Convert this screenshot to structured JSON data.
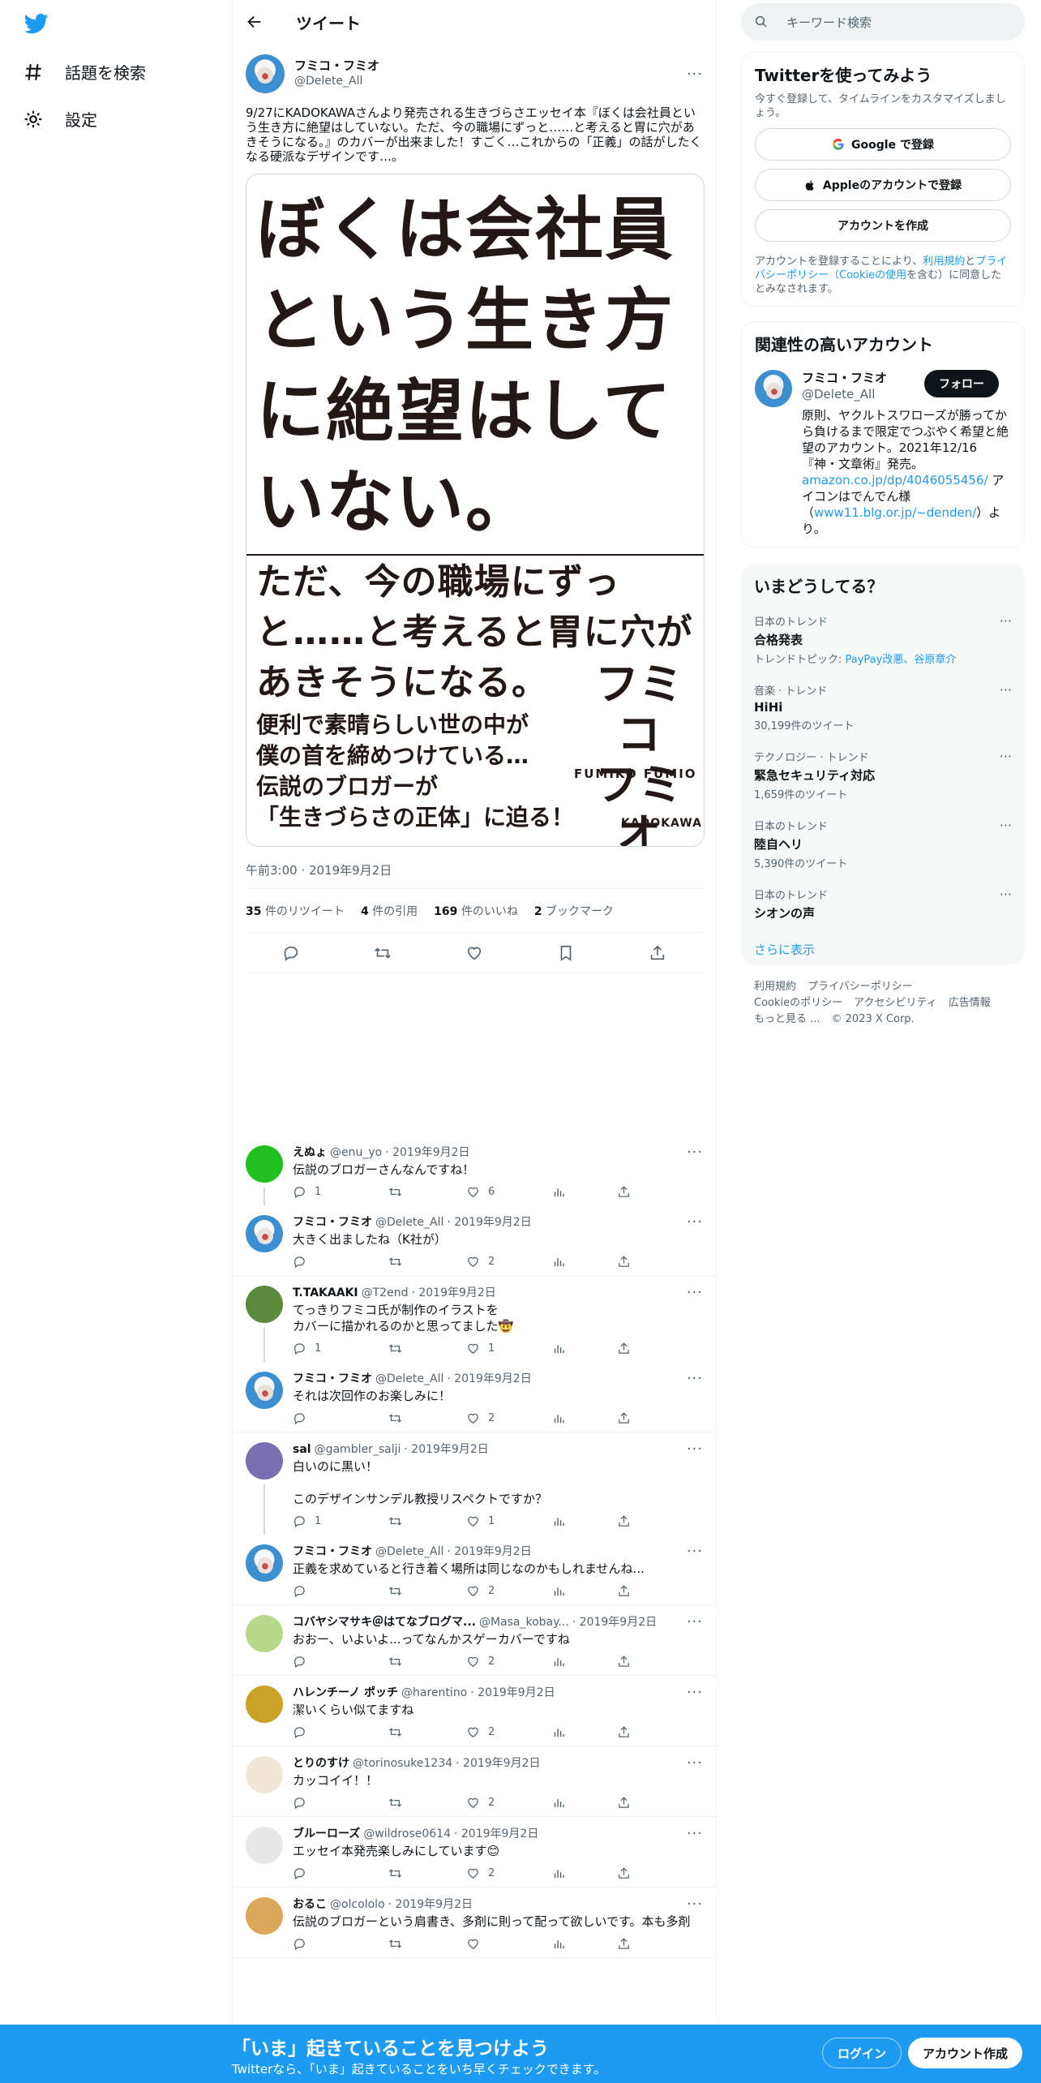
{
  "nav": {
    "explore_label": "話題を検索",
    "settings_label": "設定"
  },
  "header": {
    "title": "ツイート"
  },
  "tweet": {
    "name": "フミコ・フミオ",
    "handle": "@Delete_All",
    "text": "9/27にKADOKAWAさんより発売される生きづらさエッセイ本『ぼくは会社員という生き方に絶望はしていない。ただ、今の職場にずっと……と考えると胃に穴があきそうになる。』のカバーが出来ました！すごく…これからの「正義」の話がしたくなる硬派なデザインです…。",
    "time": "午前3:00 · 2019年9月2日",
    "cover": {
      "title": "ぼくは会社員という生き方に絶望はしていない。",
      "subtitle": "ただ、今の職場にずっと……と考えると胃に穴があきそうになる。",
      "tagline": "便利で素晴らしい世の中が\n僕の首を締めつけている…\n伝説のブロガーが\n「生きづらさの正体」に迫る！",
      "author": "フミコ\nフミオ",
      "author_en": "FUMIKO FUMIO",
      "publisher": "KADOKAWA"
    },
    "stats": {
      "retweets": "35",
      "retweets_label": "件のリツイート",
      "quotes": "4",
      "quotes_label": "件の引用",
      "likes": "169",
      "likes_label": "件のいいね",
      "bookmarks": "2",
      "bookmarks_label": "ブックマーク"
    }
  },
  "replies": [
    {
      "name": "えぬょ",
      "handle": "@enu_yo",
      "date": "· 2019年9月2日",
      "text": "伝説のブロガーさんなんですね！",
      "replies": "1",
      "retweets": "",
      "likes": "6",
      "avatar": "#20c020",
      "thread": true
    },
    {
      "name": "フミコ・フミオ",
      "handle": "@Delete_All",
      "date": "· 2019年9月2日",
      "text": "大きく出ましたね（K社が）",
      "replies": "",
      "retweets": "",
      "likes": "2",
      "avatar": "fumiko",
      "thread": false
    },
    {
      "name": "T.TAKAAKI",
      "handle": "@T2end",
      "date": "· 2019年9月2日",
      "text": "てっきりフミコ氏が制作のイラストを\nカバーに描かれるのかと思ってました🤠",
      "replies": "1",
      "retweets": "",
      "likes": "1",
      "avatar": "#5b8a3c",
      "thread": true
    },
    {
      "name": "フミコ・フミオ",
      "handle": "@Delete_All",
      "date": "· 2019年9月2日",
      "text": "それは次回作のお楽しみに！",
      "replies": "",
      "retweets": "",
      "likes": "2",
      "avatar": "fumiko",
      "thread": false
    },
    {
      "name": "sal",
      "handle": "@gambler_salji",
      "date": "· 2019年9月2日",
      "text": "白いのに黒い！\n\nこのデザインサンデル教授リスペクトですか？",
      "replies": "1",
      "retweets": "",
      "likes": "1",
      "avatar": "#7a6fb0",
      "thread": true
    },
    {
      "name": "フミコ・フミオ",
      "handle": "@Delete_All",
      "date": "· 2019年9月2日",
      "text": "正義を求めていると行き着く場所は同じなのかもしれませんね...",
      "replies": "",
      "retweets": "",
      "likes": "2",
      "avatar": "fumiko",
      "thread": false
    },
    {
      "name": "コバヤシマサキ＠はてなブログマ...",
      "handle": "@Masa_kobay...",
      "date": "· 2019年9月2日",
      "text": "おおー、いよいよ...ってなんかスゲーカバーですね",
      "replies": "",
      "retweets": "",
      "likes": "2",
      "avatar": "#b8d88a",
      "thread": false
    },
    {
      "name": "ハレンチーノ ポッチ",
      "handle": "@harentino",
      "date": "· 2019年9月2日",
      "text": "潔いくらい似てますね",
      "replies": "",
      "retweets": "",
      "likes": "2",
      "avatar": "#c9a227",
      "thread": false
    },
    {
      "name": "とりのすけ",
      "handle": "@torinosuke1234",
      "date": "· 2019年9月2日",
      "text": "カッコイイ！！",
      "replies": "",
      "retweets": "",
      "likes": "2",
      "avatar": "#f2e6d8",
      "thread": false
    },
    {
      "name": "ブルーローズ",
      "handle": "@wildrose0614",
      "date": "· 2019年9月2日",
      "text": "エッセイ本発売楽しみにしています😊",
      "replies": "",
      "retweets": "",
      "likes": "2",
      "avatar": "#e8e8e8",
      "thread": false
    },
    {
      "name": "おるこ",
      "handle": "@olcololo",
      "date": "· 2019年9月2日",
      "text": "伝説のブロガーという肩書き、多剤に則って配って欲しいです。本も多剤",
      "replies": "",
      "retweets": "",
      "likes": "",
      "avatar": "#d9a85a",
      "thread": false
    }
  ],
  "sidebar": {
    "search_placeholder": "キーワード検索",
    "signup": {
      "title": "Twitterを使ってみよう",
      "desc": "今すぐ登録して、タイムラインをカスタマイズしましょう。",
      "google": "Google で登録",
      "apple": "Appleのアカウントで登録",
      "create": "アカウントを作成",
      "legal_prefix": "アカウントを登録することにより、",
      "legal_terms": "利用規約",
      "legal_and": "と",
      "legal_privacy": "プライバシーポリシー",
      "legal_cookie": "（Cookieの使用",
      "legal_suffix": "を含む）に同意したとみなされます。"
    },
    "related": {
      "title": "関連性の高いアカウント",
      "name": "フミコ・フミオ",
      "handle": "@Delete_All",
      "follow": "フォロー",
      "bio_text": "原則、ヤクルトスワローズが勝ってから負けるまで限定でつぶやく希望と絶望のアカウント。2021年12/16『神・文章術』発売。",
      "bio_link": "amazon.co.jp/dp/4046055456/",
      "bio_text2": " アイコンはでんでん様（",
      "bio_link2": "www11.blg.or.jp/~denden/",
      "bio_text3": "）より。"
    },
    "trends": {
      "title": "いまどうしてる？",
      "items": [
        {
          "cat": "日本のトレンド",
          "name": "合格発表",
          "meta": "トレンドトピック: ",
          "meta_link": "PayPay改悪、谷原章介"
        },
        {
          "cat": "音楽 · トレンド",
          "name": "HiHi",
          "meta": "30,199件のツイート",
          "meta_link": ""
        },
        {
          "cat": "テクノロジー · トレンド",
          "name": "緊急セキュリティ対応",
          "meta": "1,659件のツイート",
          "meta_link": ""
        },
        {
          "cat": "日本のトレンド",
          "name": "陸自ヘリ",
          "meta": "5,390件のツイート",
          "meta_link": ""
        },
        {
          "cat": "日本のトレンド",
          "name": "シオンの声",
          "meta": "",
          "meta_link": ""
        }
      ],
      "show_more": "さらに表示"
    },
    "footer": {
      "line1": [
        "利用規約",
        "プライバシーポリシー"
      ],
      "line2": [
        "Cookieのポリシー",
        "アクセシビリティ",
        "広告情報"
      ],
      "line3": [
        "もっと見る ...",
        "© 2023 X Corp."
      ]
    }
  },
  "bottombar": {
    "title": "「いま」起きていることを見つけよう",
    "sub": "Twitterなら、「いま」起きていることをいち早くチェックできます。",
    "login": "ログイン",
    "signup": "アカウント作成"
  }
}
